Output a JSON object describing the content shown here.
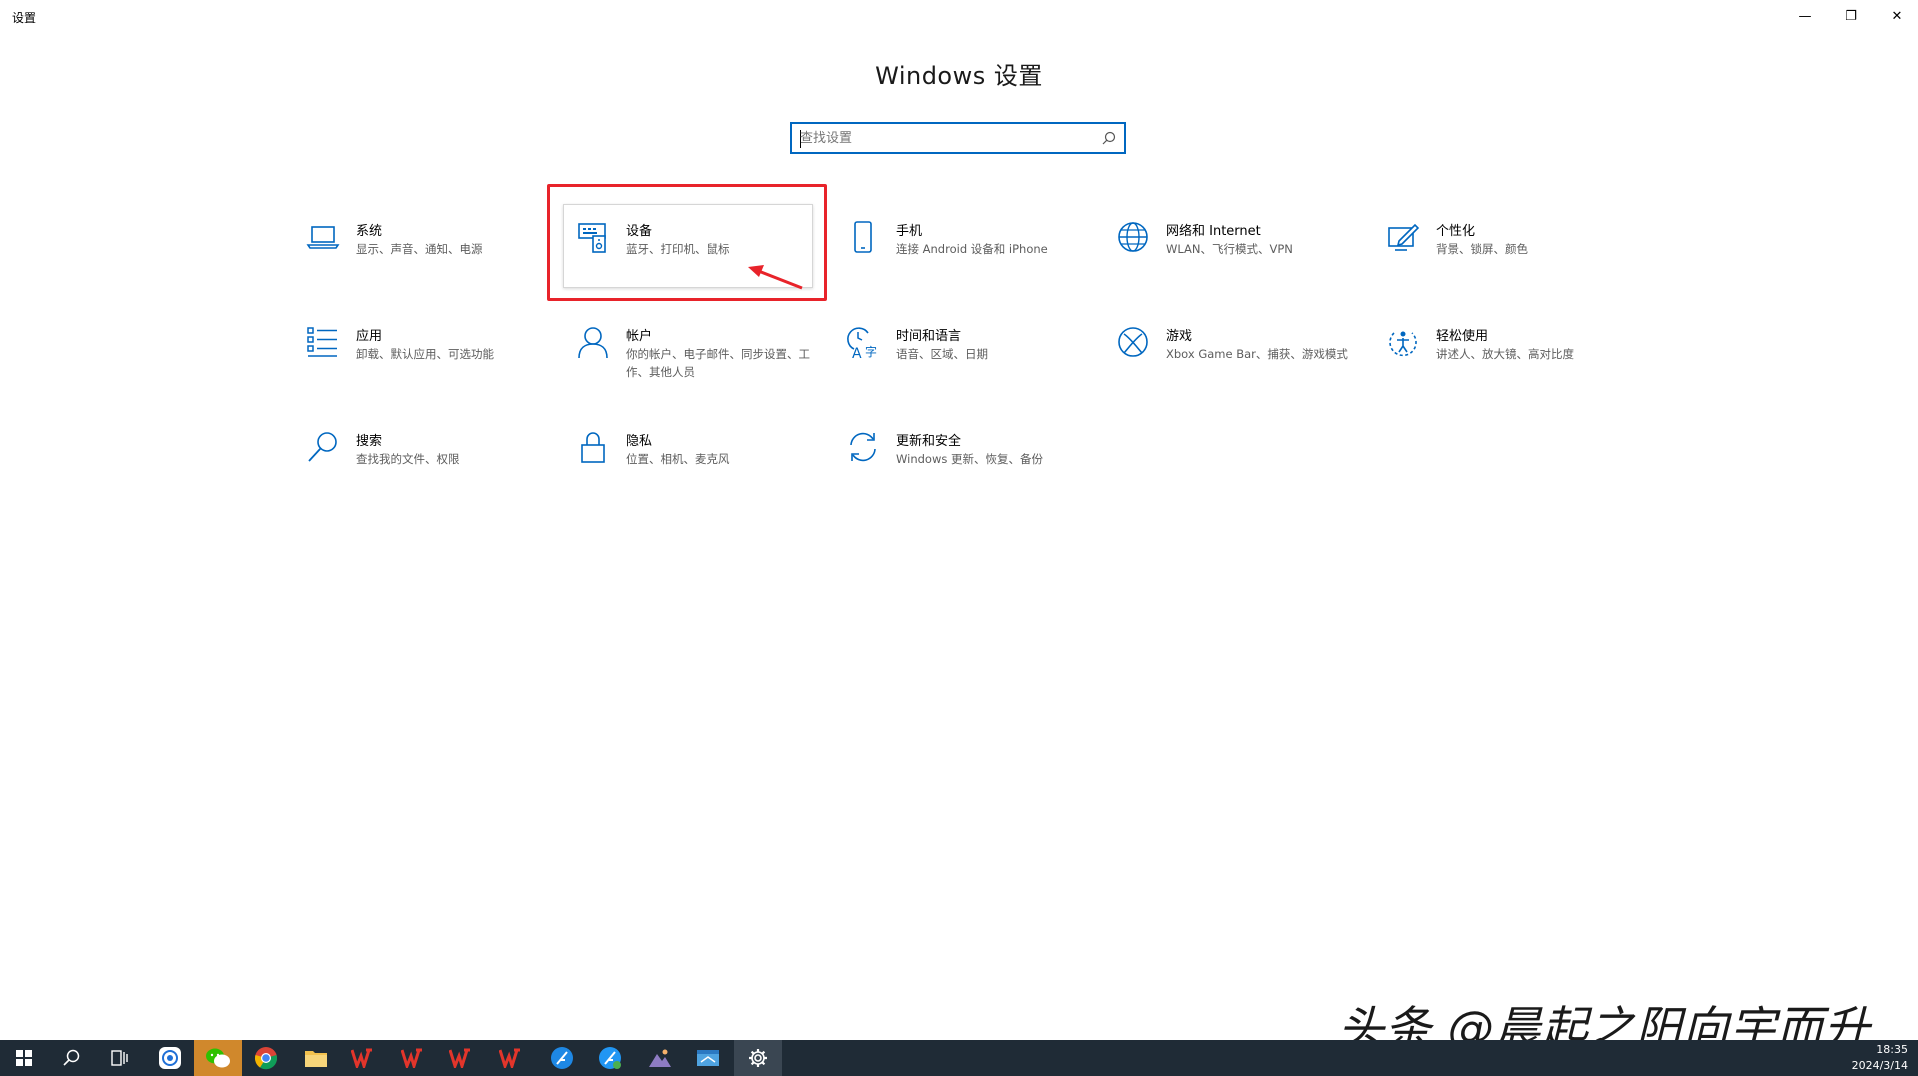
{
  "window": {
    "title": "设置",
    "controls": {
      "minimize": "—",
      "maximize": "❐",
      "close": "✕"
    }
  },
  "header": {
    "title": "Windows 设置"
  },
  "search": {
    "placeholder": "查找设置"
  },
  "tiles": [
    {
      "title": "系统",
      "desc": "显示、声音、通知、电源",
      "icon": "laptop-icon"
    },
    {
      "title": "设备",
      "desc": "蓝牙、打印机、鼠标",
      "icon": "devices-icon"
    },
    {
      "title": "手机",
      "desc": "连接 Android 设备和 iPhone",
      "icon": "phone-icon"
    },
    {
      "title": "网络和 Internet",
      "desc": "WLAN、飞行模式、VPN",
      "icon": "globe-icon"
    },
    {
      "title": "个性化",
      "desc": "背景、锁屏、颜色",
      "icon": "personalization-icon"
    },
    {
      "title": "应用",
      "desc": "卸载、默认应用、可选功能",
      "icon": "apps-list-icon"
    },
    {
      "title": "帐户",
      "desc": "你的帐户、电子邮件、同步设置、工作、其他人员",
      "icon": "person-icon"
    },
    {
      "title": "时间和语言",
      "desc": "语音、区域、日期",
      "icon": "time-language-icon"
    },
    {
      "title": "游戏",
      "desc": "Xbox Game Bar、捕获、游戏模式",
      "icon": "xbox-icon"
    },
    {
      "title": "轻松使用",
      "desc": "讲述人、放大镜、高对比度",
      "icon": "ease-of-access-icon"
    },
    {
      "title": "搜索",
      "desc": "查找我的文件、权限",
      "icon": "search-icon"
    },
    {
      "title": "隐私",
      "desc": "位置、相机、麦克风",
      "icon": "lock-icon"
    },
    {
      "title": "更新和安全",
      "desc": "Windows 更新、恢复、备份",
      "icon": "refresh-icon"
    }
  ],
  "watermark": "头条 @晨起之阳向宇而升",
  "taskbar": {
    "time": "18:35",
    "date": "2024/3/14",
    "accent": "#0067c0"
  }
}
